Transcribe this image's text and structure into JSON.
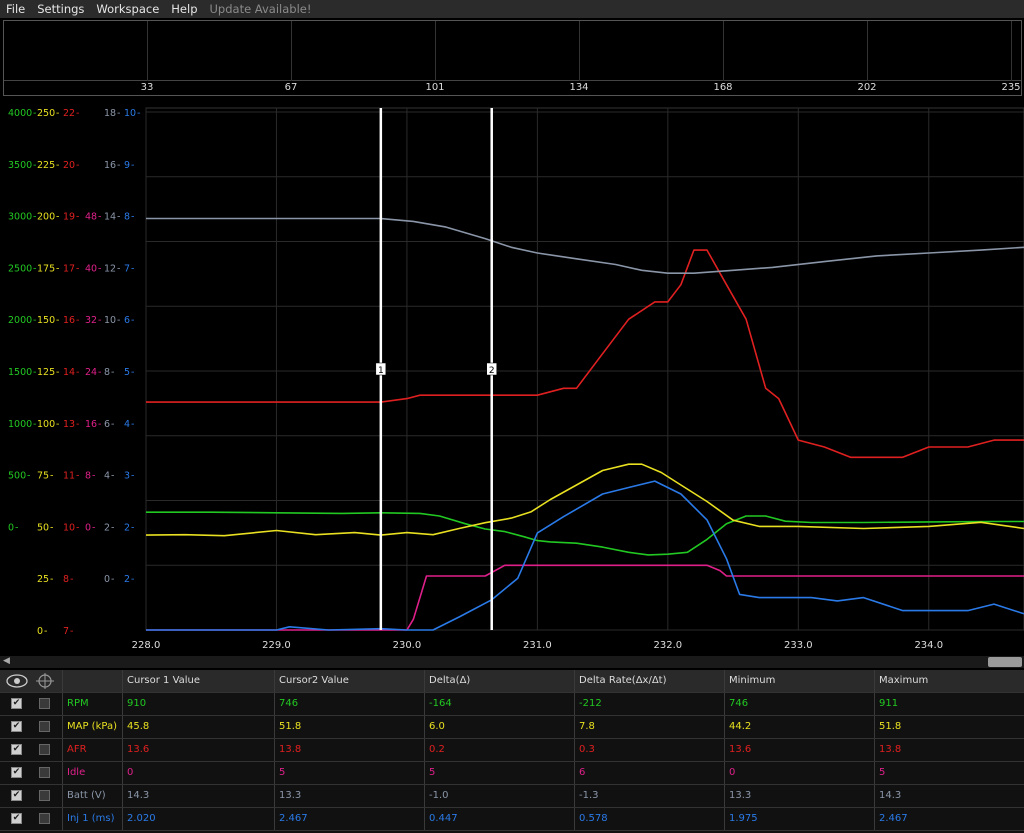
{
  "menu": {
    "file": "File",
    "settings": "Settings",
    "workspace": "Workspace",
    "help": "Help",
    "update": "Update Available!"
  },
  "overview": {
    "ticks": [
      "33",
      "67",
      "101",
      "134",
      "168",
      "202",
      "235"
    ]
  },
  "colors": {
    "rpm": "#22c822",
    "map": "#e8e020",
    "afr": "#e02020",
    "idle": "#e0208a",
    "batt": "#8a96a8",
    "inj": "#2a7ae8",
    "grid": "#2a2a2a"
  },
  "chart_data": {
    "type": "line",
    "x_ticks": [
      "228.0",
      "229.0",
      "230.0",
      "231.0",
      "232.0",
      "233.0",
      "234.0"
    ],
    "xlim": [
      228.0,
      234.73
    ],
    "axes": [
      {
        "name": "rpm",
        "ticks": [
          "4000",
          "3500",
          "3000",
          "2500",
          "2000",
          "1500",
          "1000",
          "500",
          "0"
        ]
      },
      {
        "name": "map",
        "ticks": [
          "250",
          "225",
          "200",
          "175",
          "150",
          "125",
          "100",
          "75",
          "50",
          "25",
          "0"
        ]
      },
      {
        "name": "afr",
        "ticks": [
          "22",
          "20",
          "19",
          "17",
          "16",
          "14",
          "13",
          "11",
          "10",
          "8",
          "7"
        ]
      },
      {
        "name": "idle",
        "ticks": [
          "48",
          "40",
          "32",
          "24",
          "16",
          "8",
          "0"
        ]
      },
      {
        "name": "batt",
        "ticks": [
          "18",
          "16",
          "14",
          "12",
          "10",
          "8",
          "6",
          "4",
          "2",
          "0"
        ]
      },
      {
        "name": "inj",
        "ticks": [
          "10",
          "9",
          "8",
          "7",
          "6",
          "5",
          "4",
          "3",
          "2",
          "2"
        ]
      }
    ],
    "cursors": [
      {
        "label": "1",
        "x": 229.8
      },
      {
        "label": "2",
        "x": 230.65
      }
    ],
    "series": [
      {
        "name": "RPM",
        "color": "#22c822",
        "range": [
          0,
          4000
        ],
        "x": [
          228.0,
          228.5,
          229.0,
          229.5,
          229.8,
          230.1,
          230.25,
          230.45,
          230.6,
          230.75,
          230.9,
          231.0,
          231.1,
          231.3,
          231.5,
          231.7,
          231.85,
          232.0,
          232.15,
          232.3,
          232.45,
          232.6,
          232.75,
          232.9,
          233.1,
          233.5,
          234.0,
          234.5,
          234.73
        ],
        "values": [
          910,
          910,
          905,
          900,
          905,
          900,
          880,
          820,
          780,
          760,
          720,
          690,
          680,
          670,
          640,
          600,
          580,
          585,
          600,
          700,
          820,
          880,
          880,
          840,
          830,
          830,
          835,
          838,
          838
        ]
      },
      {
        "name": "MAP (kPa)",
        "color": "#e8e020",
        "range": [
          0,
          250
        ],
        "x": [
          228.0,
          228.3,
          228.6,
          229.0,
          229.3,
          229.6,
          229.8,
          230.0,
          230.2,
          230.4,
          230.6,
          230.8,
          230.95,
          231.1,
          231.3,
          231.5,
          231.7,
          231.8,
          231.95,
          232.1,
          232.3,
          232.5,
          232.7,
          233.0,
          233.5,
          234.0,
          234.4,
          234.73
        ],
        "values": [
          45.8,
          46,
          45.5,
          48,
          46,
          47,
          45.8,
          47,
          46,
          49,
          51.8,
          54,
          57,
          63,
          70,
          77,
          80,
          80,
          76,
          70,
          62,
          53,
          50,
          50,
          49,
          50,
          52,
          49
        ]
      },
      {
        "name": "AFR",
        "color": "#e02020",
        "range": [
          7,
          22
        ],
        "x": [
          228.0,
          229.0,
          229.8,
          230.0,
          230.1,
          230.3,
          230.65,
          231.0,
          231.2,
          231.3,
          231.5,
          231.7,
          231.9,
          232.0,
          232.1,
          232.2,
          232.3,
          232.45,
          232.6,
          232.75,
          232.85,
          233.0,
          233.2,
          233.4,
          233.6,
          233.8,
          234.0,
          234.3,
          234.5,
          234.73
        ],
        "values": [
          13.6,
          13.6,
          13.6,
          13.7,
          13.8,
          13.8,
          13.8,
          13.8,
          14.0,
          14.0,
          15.0,
          16.0,
          16.5,
          16.5,
          17.0,
          18.0,
          18.0,
          17.0,
          16.0,
          14.0,
          13.7,
          12.5,
          12.3,
          12.0,
          12.0,
          12.0,
          12.3,
          12.3,
          12.5,
          12.5
        ]
      },
      {
        "name": "Idle",
        "color": "#e0208a",
        "range": [
          0,
          48
        ],
        "x": [
          228.0,
          229.8,
          230.0,
          230.05,
          230.15,
          230.6,
          230.75,
          231.0,
          232.0,
          232.2,
          232.3,
          232.4,
          232.45,
          233.0,
          234.0,
          234.73
        ],
        "values": [
          0,
          0,
          0,
          1,
          5,
          5,
          6,
          6,
          6,
          6,
          6,
          5.5,
          5,
          5,
          5,
          5
        ]
      },
      {
        "name": "Batt (V)",
        "color": "#8a96a8",
        "range": [
          0,
          18
        ],
        "x": [
          228.0,
          229.0,
          229.8,
          230.05,
          230.3,
          230.6,
          230.8,
          231.0,
          231.3,
          231.6,
          231.8,
          232.0,
          232.2,
          232.5,
          232.8,
          233.2,
          233.6,
          234.0,
          234.4,
          234.73
        ],
        "values": [
          14.3,
          14.3,
          14.3,
          14.2,
          14.0,
          13.6,
          13.3,
          13.1,
          12.9,
          12.7,
          12.5,
          12.4,
          12.4,
          12.5,
          12.6,
          12.8,
          13.0,
          13.1,
          13.2,
          13.3
        ]
      },
      {
        "name": "Inj 1 (ms)",
        "color": "#2a7ae8",
        "range": [
          2,
          10
        ],
        "x": [
          228.0,
          228.5,
          229.0,
          229.1,
          229.4,
          229.8,
          230.0,
          230.2,
          230.4,
          230.65,
          230.85,
          231.0,
          231.2,
          231.5,
          231.7,
          231.9,
          232.1,
          232.3,
          232.45,
          232.55,
          232.7,
          232.9,
          233.1,
          233.3,
          233.5,
          233.8,
          234.0,
          234.3,
          234.5,
          234.73
        ],
        "values": [
          2.0,
          2.0,
          2.0,
          2.05,
          2.0,
          2.02,
          2.0,
          2.0,
          2.2,
          2.467,
          2.8,
          3.5,
          3.75,
          4.1,
          4.2,
          4.3,
          4.1,
          3.7,
          3.1,
          2.55,
          2.5,
          2.5,
          2.5,
          2.45,
          2.5,
          2.3,
          2.3,
          2.3,
          2.4,
          2.25
        ]
      }
    ]
  },
  "table": {
    "headers": [
      "Cursor 1 Value",
      "Cursor2 Value",
      "Delta(Δ)",
      "Delta Rate(Δx/Δt)",
      "Minimum",
      "Maximum"
    ],
    "rows": [
      {
        "name": "RPM",
        "color": "#22c822",
        "visible": true,
        "values": [
          "910",
          "746",
          "-164",
          "-212",
          "746",
          "911"
        ]
      },
      {
        "name": "MAP (kPa)",
        "color": "#e8e020",
        "visible": true,
        "values": [
          "45.8",
          "51.8",
          "6.0",
          "7.8",
          "44.2",
          "51.8"
        ]
      },
      {
        "name": "AFR",
        "color": "#e02020",
        "visible": true,
        "values": [
          "13.6",
          "13.8",
          "0.2",
          "0.3",
          "13.6",
          "13.8"
        ]
      },
      {
        "name": "Idle",
        "color": "#e0208a",
        "visible": true,
        "values": [
          "0",
          "5",
          "5",
          "6",
          "0",
          "5"
        ]
      },
      {
        "name": "Batt (V)",
        "color": "#8a96a8",
        "visible": true,
        "values": [
          "14.3",
          "13.3",
          "-1.0",
          "-1.3",
          "13.3",
          "14.3"
        ]
      },
      {
        "name": "Inj 1 (ms)",
        "color": "#2a7ae8",
        "visible": true,
        "values": [
          "2.020",
          "2.467",
          "0.447",
          "0.578",
          "1.975",
          "2.467"
        ]
      }
    ]
  }
}
